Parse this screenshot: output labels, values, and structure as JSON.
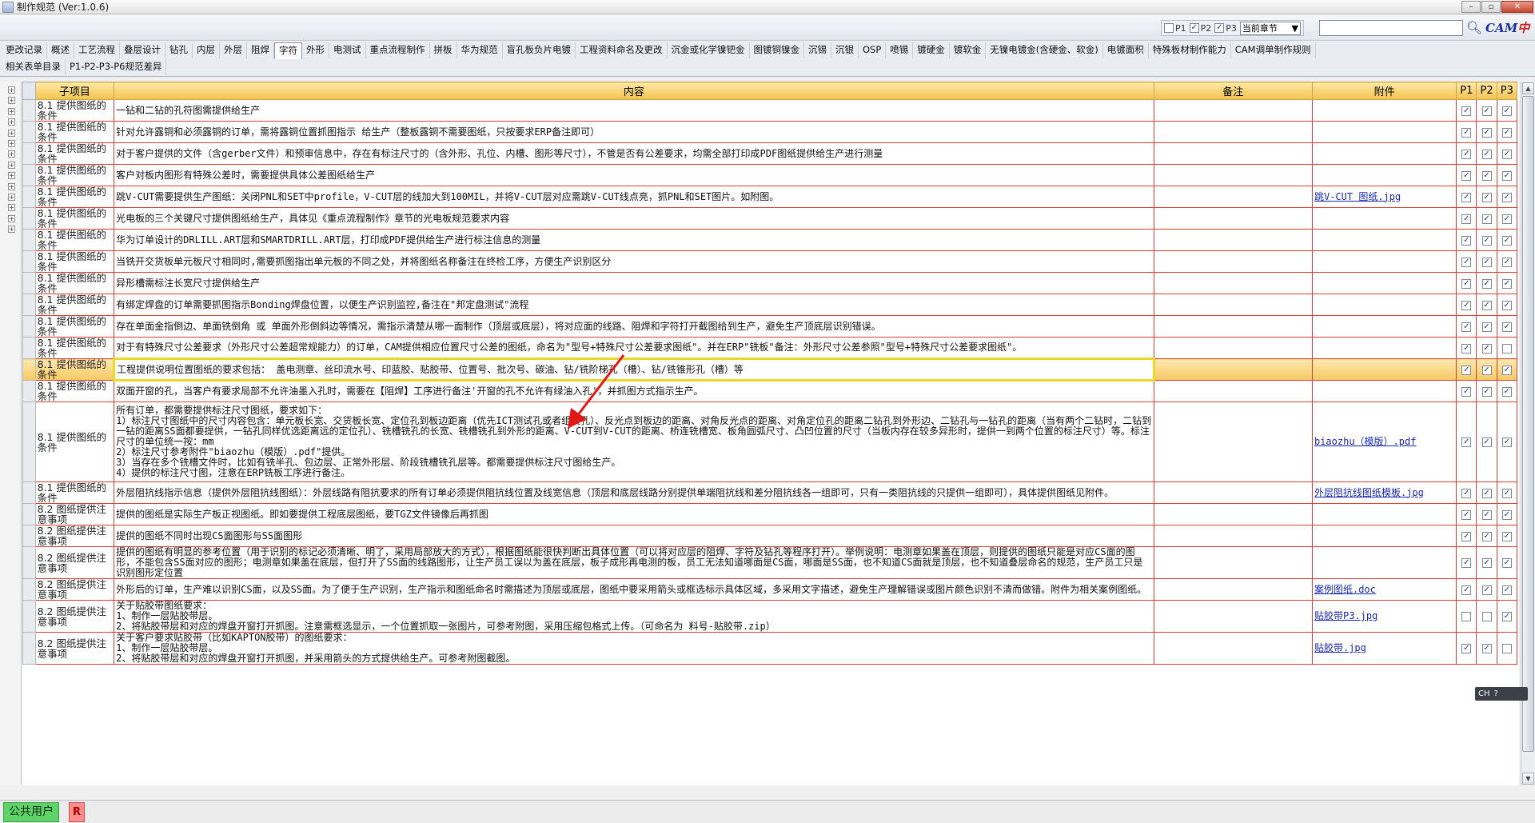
{
  "window": {
    "title": "制作规范 (Ver:1.0.6)",
    "controls": [
      "–",
      "▫",
      "✕"
    ]
  },
  "toolbar": {
    "filters": [
      {
        "label": "P1",
        "checked": false
      },
      {
        "label": "P2",
        "checked": true
      },
      {
        "label": "P3",
        "checked": true
      }
    ],
    "scope_select": "当前章节",
    "search_placeholder": "",
    "logo_text": "CAM中心"
  },
  "tabs": {
    "row1": [
      "更改记录",
      "概述",
      "工艺流程",
      "叠层设计",
      "钻孔",
      "内层",
      "外层",
      "阻焊",
      "字符",
      "外形",
      "电测试",
      "重点流程制作",
      "拼板",
      "华为规范",
      "盲孔板负片电镀",
      "工程资料命名及更改",
      "沉金或化学镍钯金",
      "图镀铜镍金",
      "沉锡",
      "沉银",
      "OSP",
      "喷锡",
      "镀硬金",
      "镀软金",
      "无镍电镀金(含硬金、软金)",
      "电镀面积",
      "特殊板材制作能力",
      "CAM调单制作规则"
    ],
    "row2": [
      "相关表单目录",
      "P1-P2-P3-P6规范差异"
    ],
    "active": "字符"
  },
  "grid": {
    "columns": {
      "sub": "子项目",
      "content": "内容",
      "remark": "备注",
      "attach": "附件",
      "p1": "P1",
      "p2": "P2",
      "p3": "P3"
    },
    "rows": [
      {
        "sub": "8.1 提供图纸的条件",
        "content": "一钻和二钻的孔符图需提供给生产",
        "remark": "",
        "attach": "",
        "p1": true,
        "p2": true,
        "p3": true
      },
      {
        "sub": "8.1 提供图纸的条件",
        "content": "针对允许露铜和必须露铜的订单，需将露铜位置抓图指示 给生产（整板露铜不需要图纸，只按要求ERP备注即可）",
        "remark": "",
        "attach": "",
        "p1": true,
        "p2": true,
        "p3": true
      },
      {
        "sub": "8.1 提供图纸的条件",
        "content": "对于客户提供的文件（含gerber文件）和预审信息中，存在有标注尺寸的（含外形、孔位、内槽、图形等尺寸），不管是否有公差要求，均需全部打印成PDF图纸提供给生产进行测量",
        "remark": "",
        "attach": "",
        "p1": true,
        "p2": true,
        "p3": true
      },
      {
        "sub": "8.1 提供图纸的条件",
        "content": "客户对板内图形有特殊公差时，需要提供具体公差图纸给生产",
        "remark": "",
        "attach": "",
        "p1": true,
        "p2": true,
        "p3": true
      },
      {
        "sub": "8.1 提供图纸的条件",
        "content": "跳V-CUT需要提供生产图纸：关闭PNL和SET中profile，V-CUT层的线加大到100MIL，并将V-CUT层对应需跳V-CUT线点亮，抓PNL和SET图片。如附图。",
        "remark": "",
        "attach": "跳V-CUT 图纸.jpg",
        "p1": true,
        "p2": true,
        "p3": true
      },
      {
        "sub": "8.1 提供图纸的条件",
        "content": "光电板的三个关键尺寸提供图纸给生产，具体见《重点流程制作》章节的光电板规范要求内容",
        "remark": "",
        "attach": "",
        "p1": true,
        "p2": true,
        "p3": true
      },
      {
        "sub": "8.1 提供图纸的条件",
        "content": "华为订单设计的DRLILL.ART层和SMARTDRILL.ART层，打印成PDF提供给生产进行标注信息的测量",
        "remark": "",
        "attach": "",
        "p1": true,
        "p2": true,
        "p3": true
      },
      {
        "sub": "8.1 提供图纸的条件",
        "content": "当铣开交货板单元板尺寸相同时,需要抓图指出单元板的不同之处，并将图纸名称备注在终检工序，方便生产识别区分",
        "remark": "",
        "attach": "",
        "p1": true,
        "p2": true,
        "p3": true
      },
      {
        "sub": "8.1 提供图纸的条件",
        "content": "异形槽需标注长宽尺寸提供给生产",
        "remark": "",
        "attach": "",
        "p1": true,
        "p2": true,
        "p3": true
      },
      {
        "sub": "8.1 提供图纸的条件",
        "content": "有绑定焊盘的订单需要抓图指示Bonding焊盘位置，以便生产识别监控,备注在\"邦定盘测试\"流程",
        "remark": "",
        "attach": "",
        "p1": true,
        "p2": true,
        "p3": true
      },
      {
        "sub": "8.1 提供图纸的条件",
        "content": "存在单面金指倒边、单面铣倒角 或 单面外形倒斜边等情况，需指示清楚从哪一面制作（顶层或底层），将对应面的线路、阻焊和字符打开截图给到生产，避免生产顶底层识别错误。",
        "remark": "",
        "attach": "",
        "p1": true,
        "p2": true,
        "p3": true
      },
      {
        "sub": "8.1 提供图纸的条件",
        "content": "对于有特殊尺寸公差要求（外形尺寸公差超常规能力）的订单，CAM提供相应位置尺寸公差的图纸，命名为\"型号+特殊尺寸公差要求图纸\"。并在ERP\"铣板\"备注：外形尺寸公差参照\"型号+特殊尺寸公差要求图纸\"。",
        "remark": "",
        "attach": "",
        "p1": true,
        "p2": true,
        "p3": false
      },
      {
        "sub": "8.1 提供图纸的条件",
        "content": "工程提供说明位置图纸的要求包括： 盖电测章、丝印流水号、印蓝胶、贴胶带、位置号、批次号、碳油、钻/铣阶梯孔（槽）、钻/铣锥形孔（槽）等",
        "remark": "",
        "attach": "",
        "p1": true,
        "p2": true,
        "p3": true,
        "selected": true
      },
      {
        "sub": "8.1 提供图纸的条件",
        "content": "双面开窗的孔，当客户有要求局部不允许油墨入孔时，需要在【阻焊】工序进行备注'开窗的孔不允许有绿油入孔'，并抓图方式指示生产。",
        "remark": "",
        "attach": "",
        "p1": true,
        "p2": true,
        "p3": true
      },
      {
        "sub": "8.1 提供图纸的条件",
        "content": "所有订单，都需要提供标注尺寸图纸，要求如下：\n1）标注尺寸图纸中的尺寸内容包含：单元板长宽、交货板长宽、定位孔到板边距离（优先ICT测试孔或者组装孔）、反光点到板边的距离、对角反光点的距离、对角定位孔的距离二钻孔到外形边、二钻孔与一钻孔的距离（当有两个二钻时，二钻到一钻的距离SS面都要提供，一钻孔同样优选距离远的定位孔）、铣槽铣孔的长宽、铣槽铣孔到外形的距离、V-CUT到V-CUT的距离、桥连铣槽宽、板角圆弧尺寸、凸凹位置的尺寸（当板内存在较多异形时，提供一到两个位置的标注尺寸）等。标注尺寸的单位统一按：mm\n2）标注尺寸参考附件\"biaozhu（模版）.pdf\"提供。\n3）当存在多个铣槽文件时，比如有铣半孔、包边层、正常外形层、阶段铣槽铣孔层等。都需要提供标注尺寸图给生产。\n4）提供的标注尺寸图，注意在ERP铣板工序进行备注。",
        "remark": "",
        "attach": "biaozhu（模版）.pdf",
        "p1": true,
        "p2": true,
        "p3": true
      },
      {
        "sub": "8.1 提供图纸的条件",
        "content": "外层阻抗线指示信息（提供外层阻抗线图纸）：外层线路有阻抗要求的所有订单必须提供阻抗线位置及线宽信息（顶层和底层线路分别提供单端阻抗线和差分阻抗线各一组即可，只有一类阻抗线的只提供一组即可），具体提供图纸见附件。",
        "remark": "",
        "attach": "外层阻抗线图纸模板.jpg",
        "p1": true,
        "p2": true,
        "p3": true
      },
      {
        "sub": "8.2 图纸提供注意事项",
        "content": "提供的图纸是实际生产板正视图纸。即如要提供工程底层图纸，要TGZ文件镜像后再抓图",
        "remark": "",
        "attach": "",
        "p1": true,
        "p2": true,
        "p3": true
      },
      {
        "sub": "8.2 图纸提供注意事项",
        "content": "提供的图纸不同时出现CS面图形与SS面图形",
        "remark": "",
        "attach": "",
        "p1": true,
        "p2": true,
        "p3": true
      },
      {
        "sub": "8.2 图纸提供注意事项",
        "content": "提供的图纸有明显的参考位置（用于识别的标记必须清晰、明了，采用局部放大的方式），根据图纸能很快判断出具体位置（可以将对应层的阻焊、字符及钻孔等程序打开）。举例说明：电测章如果盖在顶层，则提供的图纸只能是对应CS面的图形，不能包含SS面对应的图形；电测章如果盖在底层，但打开了SS面的线路图形，让生产员工误以为盖在底层，板子成形再电测的板，员工无法知道哪面是CS面，哪面是SS面，也不知道CS面就是顶层，也不知道叠层命名的规范，生产员工只是识别图形定位置",
        "remark": "",
        "attach": "",
        "p1": true,
        "p2": true,
        "p3": true
      },
      {
        "sub": "8.2 图纸提供注意事项",
        "content": "外形后的订单，生产难以识别CS面，以及SS面。为了便于生产识别，生产指示和图纸命名时需描述为顶层或底层，图纸中要采用箭头或框选标示具体区域，多采用文字描述，避免生产理解错误或图片颜色识别不清而做错。附件为相关案例图纸。",
        "remark": "",
        "attach": "案例图纸.doc",
        "p1": true,
        "p2": true,
        "p3": true
      },
      {
        "sub": "8.2 图纸提供注意事项",
        "content": "关于贴胶带图纸要求：\n1、制作一层贴胶带层。\n2、将贴胶带层和对应的焊盘开窗打开抓图。注意需框选显示，一个位置抓取一张图片，可参考附图，采用压缩包格式上传。（可命名为 料号-贴胶带.zip）",
        "remark": "",
        "attach": "贴胶带P3.jpg",
        "p1": false,
        "p2": false,
        "p3": true
      },
      {
        "sub": "8.2 图纸提供注意事项",
        "content": "关于客户要求贴胶带（比如KAPTON胶带）的图纸要求：\n1、制作一层贴胶带层。\n2、将贴胶带层和对应的焊盘开窗打开抓图，并采用箭头的方式提供给生产。可参考附图截图。",
        "remark": "",
        "attach": "贴胶带.jpg",
        "p1": true,
        "p2": true,
        "p3": false
      }
    ]
  },
  "ime": {
    "label": "CH",
    "help": "?"
  },
  "status": {
    "user": "公共用户",
    "role": "R"
  },
  "colors": {
    "header": "#f4c24b",
    "grid_border": "#d7413d",
    "selected_row": "#f7c964",
    "highlight_box": "#e8d92a",
    "arrow": "#e01818",
    "user_badge": "#5fd36a",
    "role_badge": "#fb8d8d"
  }
}
